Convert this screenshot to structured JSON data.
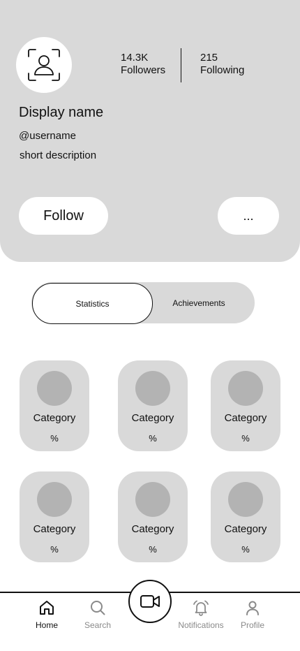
{
  "profile": {
    "followers_count": "14.3K",
    "followers_label": "Followers",
    "following_count": "215",
    "following_label": "Following",
    "display_name": "Display name",
    "username": "@username",
    "description": "short description",
    "follow_label": "Follow",
    "more_label": "..."
  },
  "tabs": {
    "active": "Statistics",
    "inactive": "Achievements"
  },
  "categories": [
    {
      "label": "Category",
      "value": "%"
    },
    {
      "label": "Category",
      "value": "%"
    },
    {
      "label": "Category",
      "value": "%"
    },
    {
      "label": "Category",
      "value": "%"
    },
    {
      "label": "Category",
      "value": "%"
    },
    {
      "label": "Category",
      "value": "%"
    }
  ],
  "nav": {
    "items": [
      {
        "label": "Home",
        "icon": "home-icon",
        "active": true
      },
      {
        "label": "Search",
        "icon": "search-icon",
        "active": false
      },
      {
        "label": "Notifications",
        "icon": "bell-icon",
        "active": false
      },
      {
        "label": "Profile",
        "icon": "user-icon",
        "active": false
      }
    ],
    "center_icon": "video-camera-icon"
  },
  "colors": {
    "surface": "#d9d9d9",
    "placeholder": "#b3b3b3",
    "text": "#111111",
    "muted": "#8a8a8a"
  }
}
